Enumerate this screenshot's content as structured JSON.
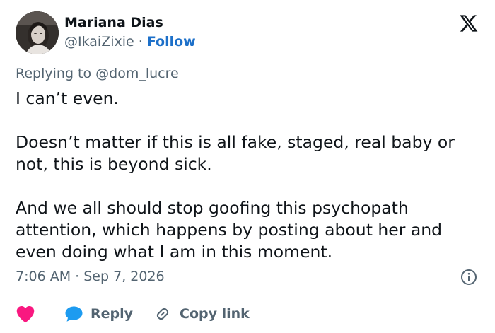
{
  "author": {
    "name": "Mariana Dias",
    "handle": "@IkaiZixie",
    "separator": "·",
    "follow_label": "Follow"
  },
  "logo_icon": "x-logo-icon",
  "reply_context": {
    "prefix": "Replying to",
    "target": "@dom_lucre"
  },
  "tweet": {
    "paragraphs": [
      "I can’t even.",
      "Doesn’t matter if this is all fake, staged, real baby or not, this is beyond sick.",
      "And we all should stop goofing this psychopath attention, which happens by posting about her and even doing what I am in this moment."
    ]
  },
  "meta": {
    "time": "7:06 AM",
    "separator": "·",
    "date": "Sep 7, 2026",
    "info_icon": "info-icon"
  },
  "actions": {
    "like_icon": "heart-icon",
    "reply_icon": "speech-bubble-icon",
    "reply_label": "Reply",
    "copy_icon": "link-icon",
    "copy_label": "Copy link"
  },
  "colors": {
    "text": "#0f1419",
    "secondary": "#536471",
    "follow": "#1d70c9",
    "like": "#f91880",
    "reply": "#1d9bf0",
    "divider": "#cfd9de"
  }
}
